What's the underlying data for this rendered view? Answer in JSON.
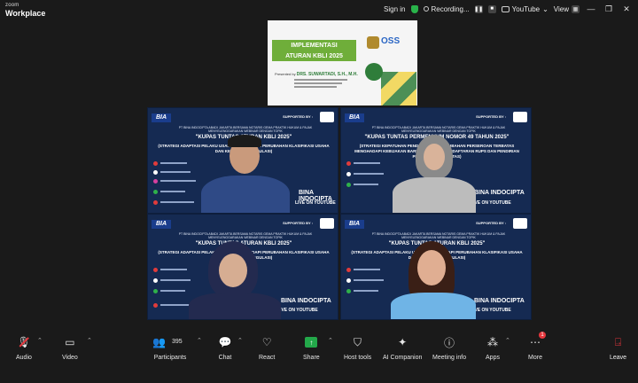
{
  "app": {
    "brand_top": "zoom",
    "brand_bottom": "Workplace"
  },
  "titlebar": {
    "sign_in": "Sign in",
    "recording": "Recording...",
    "youtube": "YouTube",
    "view": "View"
  },
  "shared_slide": {
    "title_line1": "IMPLEMENTASI",
    "title_line2": "ATURAN KBLI 2025",
    "logo_text": "OSS",
    "presenter_label": "Presented by",
    "presenter_name": "DRS. SUWARTADI, S.H., M.H."
  },
  "tiles": [
    {
      "org": "BIA",
      "supported": "SUPPORTED BY :",
      "header": "PT BINA INDOCIPTA ABADI JAKARTA BERSAMA NOTARIS GEMA PRAKTIK HUKUM & PAJAK MENYELENGGARAKAN WEBINAR DENGAN TOPIK",
      "kupas": "\"KUPAS TUNTAS ATURAN KBLI 2025\"",
      "strategy": "(STRATEGI ADAPTASI PELAKU USAHA MENGHADAPI PERUBAHAN KLASIFIKASI USAHA DAN KEPATUHAN REGULASI)",
      "bina": "BINA INDOCIPTA",
      "live": "LIVE ON YOUTUBE"
    },
    {
      "org": "BIA",
      "supported": "SUPPORTED BY :",
      "header": "PT BINA INDOCIPTA ABADI JAKARTA BERSAMA NOTARIS GEMA PRAKTIK HUKUM & PAJAK MENYELENGGARAKAN WEBINAR DENGAN TOPIK",
      "kupas": "\"KUPAS TUNTAS PERMENKUM NOMOR 49 TAHUN 2025\"",
      "strategy": "(STRATEGI KEPATUHAN PENDIRIAN DAN PERUBAHAN PERSEROAN TERBATAS MENGHADAPI KEBIJAKAN BARU, TATA CARA PENDAFTARAN RUPS DAN PENDIRIAN PERSEROAN TERBATAS)",
      "bina": "BINA INDOCIPTA",
      "live": "LIVE ON YOUTUBE"
    },
    {
      "org": "BIA",
      "supported": "SUPPORTED BY :",
      "header": "PT BINA INDOCIPTA ABADI JAKARTA BERSAMA NOTARIS GEMA PRAKTIK HUKUM & PAJAK MENYELENGGARAKAN WEBINAR DENGAN TOPIK",
      "kupas": "\"KUPAS TUNTAS ATURAN KBLI 2025\"",
      "strategy": "(STRATEGI ADAPTASI PELAKU USAHA MENGHADAPI PERUBAHAN KLASIFIKASI USAHA DAN KEPATUHAN REGULASI)",
      "bina": "BINA INDOCIPTA",
      "live": "LIVE ON YOUTUBE"
    },
    {
      "org": "BIA",
      "supported": "SUPPORTED BY :",
      "header": "PT BINA INDOCIPTA ABADI JAKARTA BERSAMA NOTARIS GEMA PRAKTIK HUKUM & PAJAK MENYELENGGARAKAN WEBINAR DENGAN TOPIK",
      "kupas": "\"KUPAS TUNTAS ATURAN KBLI 2025\"",
      "strategy": "(STRATEGI ADAPTASI PELAKU USAHA MENGHADAPI PERUBAHAN KLASIFIKASI USAHA DAN KEPATUHAN REGULASI)",
      "bina": "BINA INDOCIPTA",
      "live": "LIVE ON YOUTUBE"
    }
  ],
  "toolbar": {
    "audio": "Audio",
    "video": "Video",
    "participants": "Participants",
    "participants_count": "395",
    "chat": "Chat",
    "react": "React",
    "share": "Share",
    "host_tools": "Host tools",
    "ai_companion": "AI Companion",
    "meeting_info": "Meeting info",
    "apps": "Apps",
    "more": "More",
    "more_badge": "1",
    "leave": "Leave"
  },
  "colors": {
    "accent_green": "#23a84a",
    "leave_red": "#e5373d",
    "tile_bg": "#152a52"
  }
}
